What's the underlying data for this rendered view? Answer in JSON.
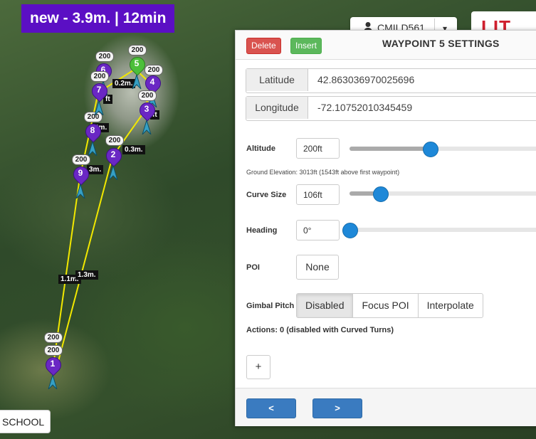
{
  "badge": "new - 3.9m. | 12min",
  "map": {
    "waypoints": [
      {
        "num": "1",
        "alt": "200"
      },
      {
        "num": "2",
        "alt": "200"
      },
      {
        "num": "3",
        "alt": "200"
      },
      {
        "num": "4",
        "alt": "200"
      },
      {
        "num": "5",
        "alt": "200"
      },
      {
        "num": "6",
        "alt": "200"
      },
      {
        "num": "7",
        "alt": "200"
      },
      {
        "num": "8",
        "alt": "200"
      },
      {
        "num": "9",
        "alt": "200"
      }
    ],
    "extra_alt": "200",
    "segments": [
      "0.2m.",
      "0.3m.",
      "1.1m.",
      "1.3m.",
      "3m.",
      "3m.",
      "ft",
      "ft"
    ],
    "place_label": "SCHOOL",
    "line_color": "#f2e800"
  },
  "topbar": {
    "user": "CMILD561",
    "caret": "▾",
    "logo": "LIT"
  },
  "panel": {
    "delete_label": "Delete",
    "insert_label": "Insert",
    "title": "WAYPOINT 5 SETTINGS",
    "latitude_label": "Latitude",
    "latitude_value": "42.863036970025696",
    "longitude_label": "Longitude",
    "longitude_value": "-72.10752010345459",
    "altitude_label": "Altitude",
    "altitude_value": "200ft",
    "altitude_slider_fraction": 0.42,
    "ground_note": "Ground Elevation: 3013ft (1543ft above first waypoint)",
    "curve_label": "Curve Size",
    "curve_value": "106ft",
    "curve_slider_fraction": 0.16,
    "heading_label": "Heading",
    "heading_value": "0°",
    "heading_slider_fraction": 0.0,
    "poi_label": "POI",
    "poi_value": "None",
    "gimbal_label": "Gimbal Pitch",
    "gimbal_options": [
      "Disabled",
      "Focus POI",
      "Interpolate"
    ],
    "actions_text": "Actions: 0 (disabled with Curved Turns)",
    "add_label": "+",
    "prev_label": "<",
    "next_label": ">",
    "accent": "#1e88d8"
  }
}
